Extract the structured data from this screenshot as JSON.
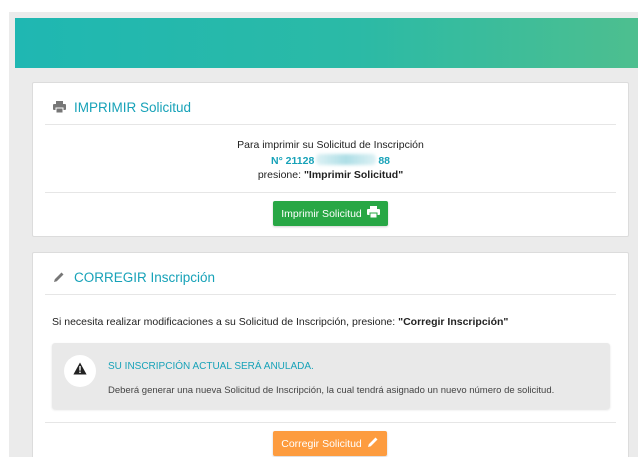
{
  "print_card": {
    "title": "IMPRIMIR Solicitud",
    "line1": "Para imprimir su Solicitud de Inscripción",
    "number_prefix": "N° 21128",
    "number_suffix": "88",
    "line3_prefix": "presione: ",
    "line3_bold": "\"Imprimir Solicitud\"",
    "button_label": "Imprimir Solicitud",
    "icons": {
      "header": "printer-icon",
      "button": "printer-icon"
    }
  },
  "correct_card": {
    "title": "CORREGIR Inscripción",
    "para_prefix": "Si necesita realizar modificaciones a su Solicitud de Inscripción, presione: ",
    "para_bold": "\"Corregir Inscripción\"",
    "alert_title": "SU INSCRIPCIÓN ACTUAL SERÁ ANULADA.",
    "alert_text": "Deberá generar una nueva Solicitud de Inscripción, la cual tendrá asignado un nuevo número de solicitud.",
    "button_label": "Corregir Solicitud",
    "icons": {
      "header": "pencil-icon",
      "alert": "warning-icon",
      "button": "pencil-icon"
    }
  },
  "colors": {
    "accent": "#17a2b8",
    "green": "#28a745",
    "orange": "#fd9c3f",
    "header_gradient_start": "#1fb7b2",
    "header_gradient_end": "#4dbf8f"
  }
}
